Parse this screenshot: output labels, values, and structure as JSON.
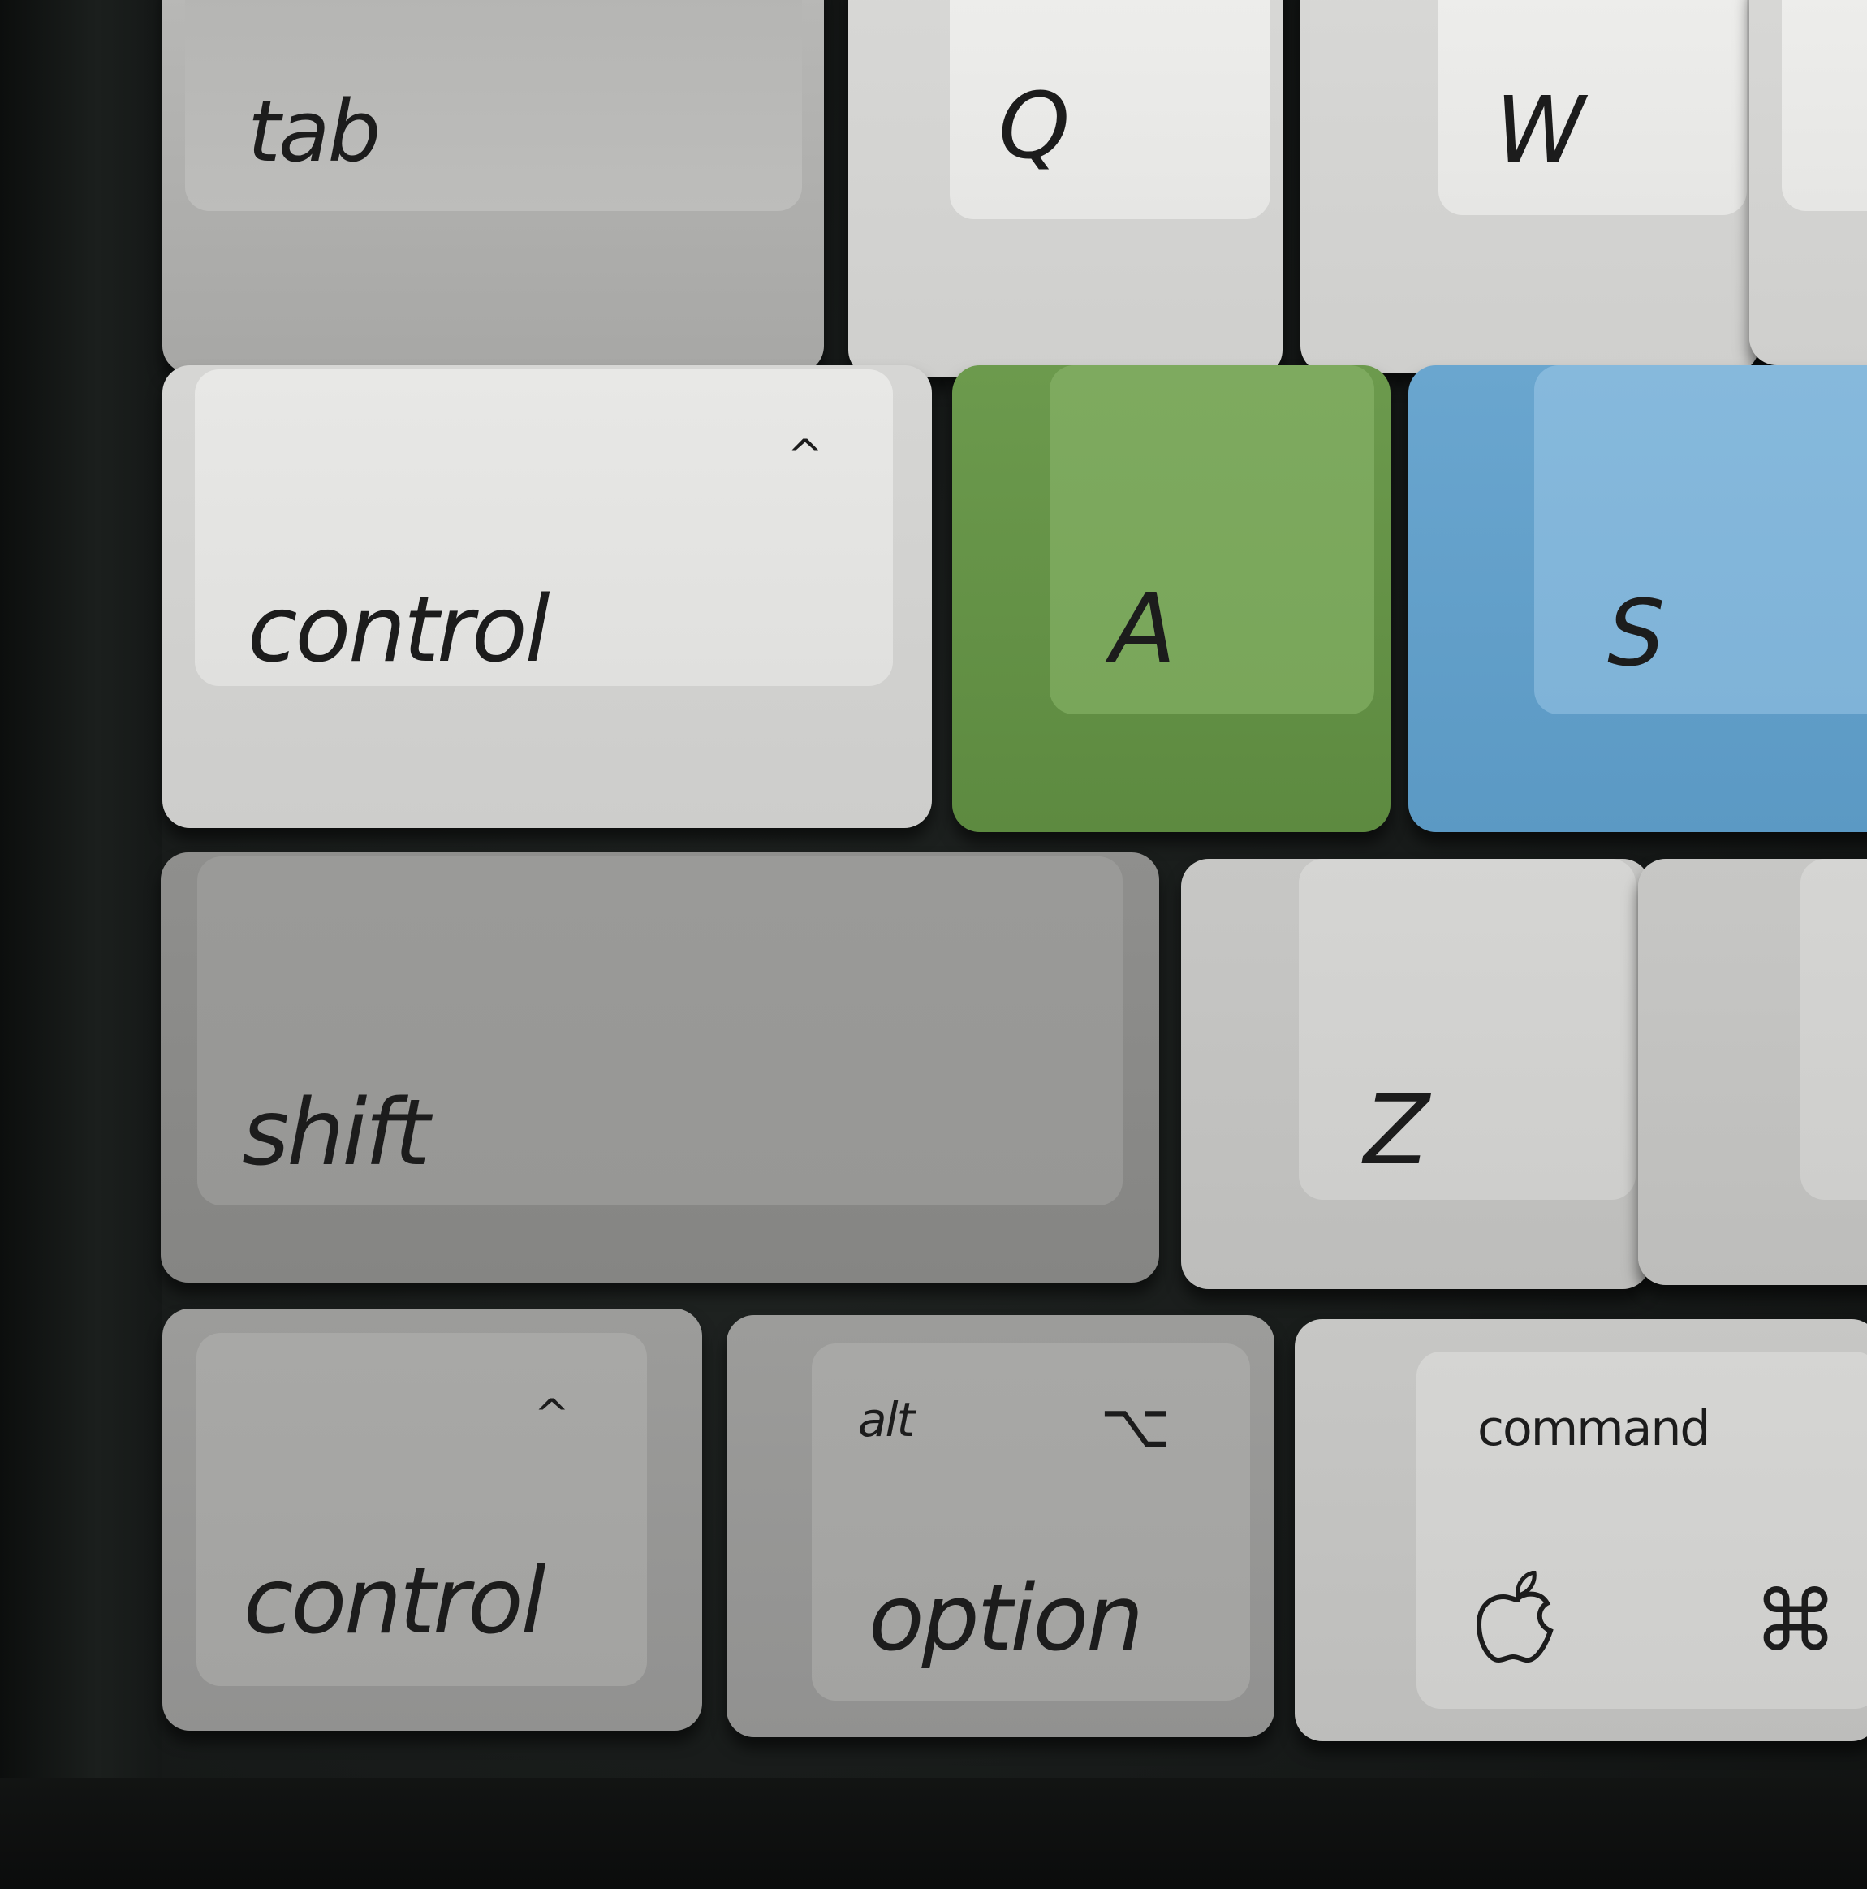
{
  "keys": {
    "tab": {
      "label": "tab"
    },
    "q": {
      "label": "Q"
    },
    "w": {
      "label": "W"
    },
    "control_top": {
      "label": "control",
      "symbol": "^"
    },
    "a": {
      "label": "A"
    },
    "s": {
      "label": "S"
    },
    "shift": {
      "label": "shift"
    },
    "z": {
      "label": "Z"
    },
    "control_bottom": {
      "label": "control",
      "symbol": "^"
    },
    "option": {
      "label": "option",
      "sublabel": "alt",
      "symbol": "⌥"
    },
    "command": {
      "label": "command",
      "symbol": "⌘",
      "logo": "apple-logo-icon"
    }
  },
  "colors": {
    "green_key": "#79a65a",
    "blue_key": "#7fb3d8",
    "case": "#161918"
  }
}
